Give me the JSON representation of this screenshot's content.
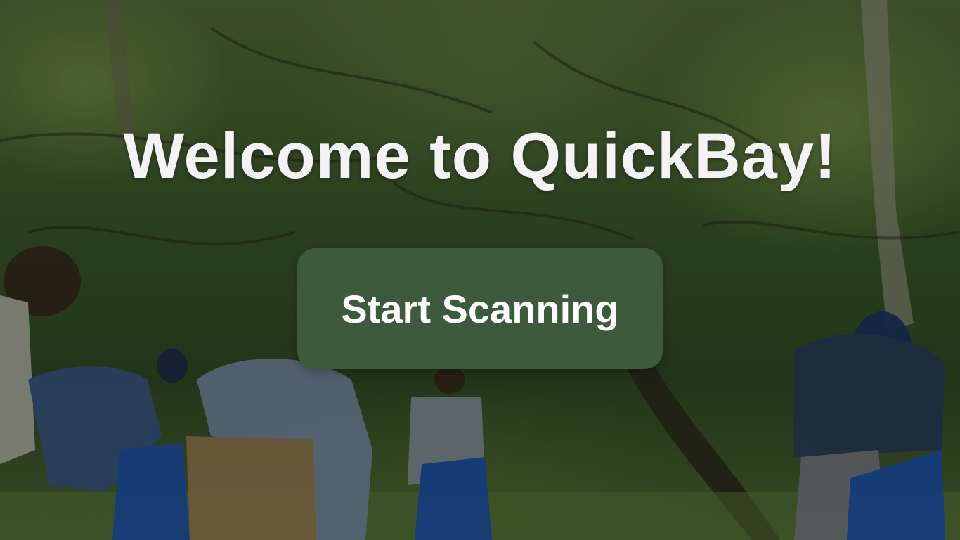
{
  "hero": {
    "title": "Welcome to QuickBay!",
    "background_image": "volunteers-cleaning-park-photo"
  },
  "actions": {
    "start_label": "Start Scanning"
  },
  "colors": {
    "button_bg": "#3d5b3c",
    "title_text": "#f3f2f5",
    "button_text": "#ffffff"
  }
}
